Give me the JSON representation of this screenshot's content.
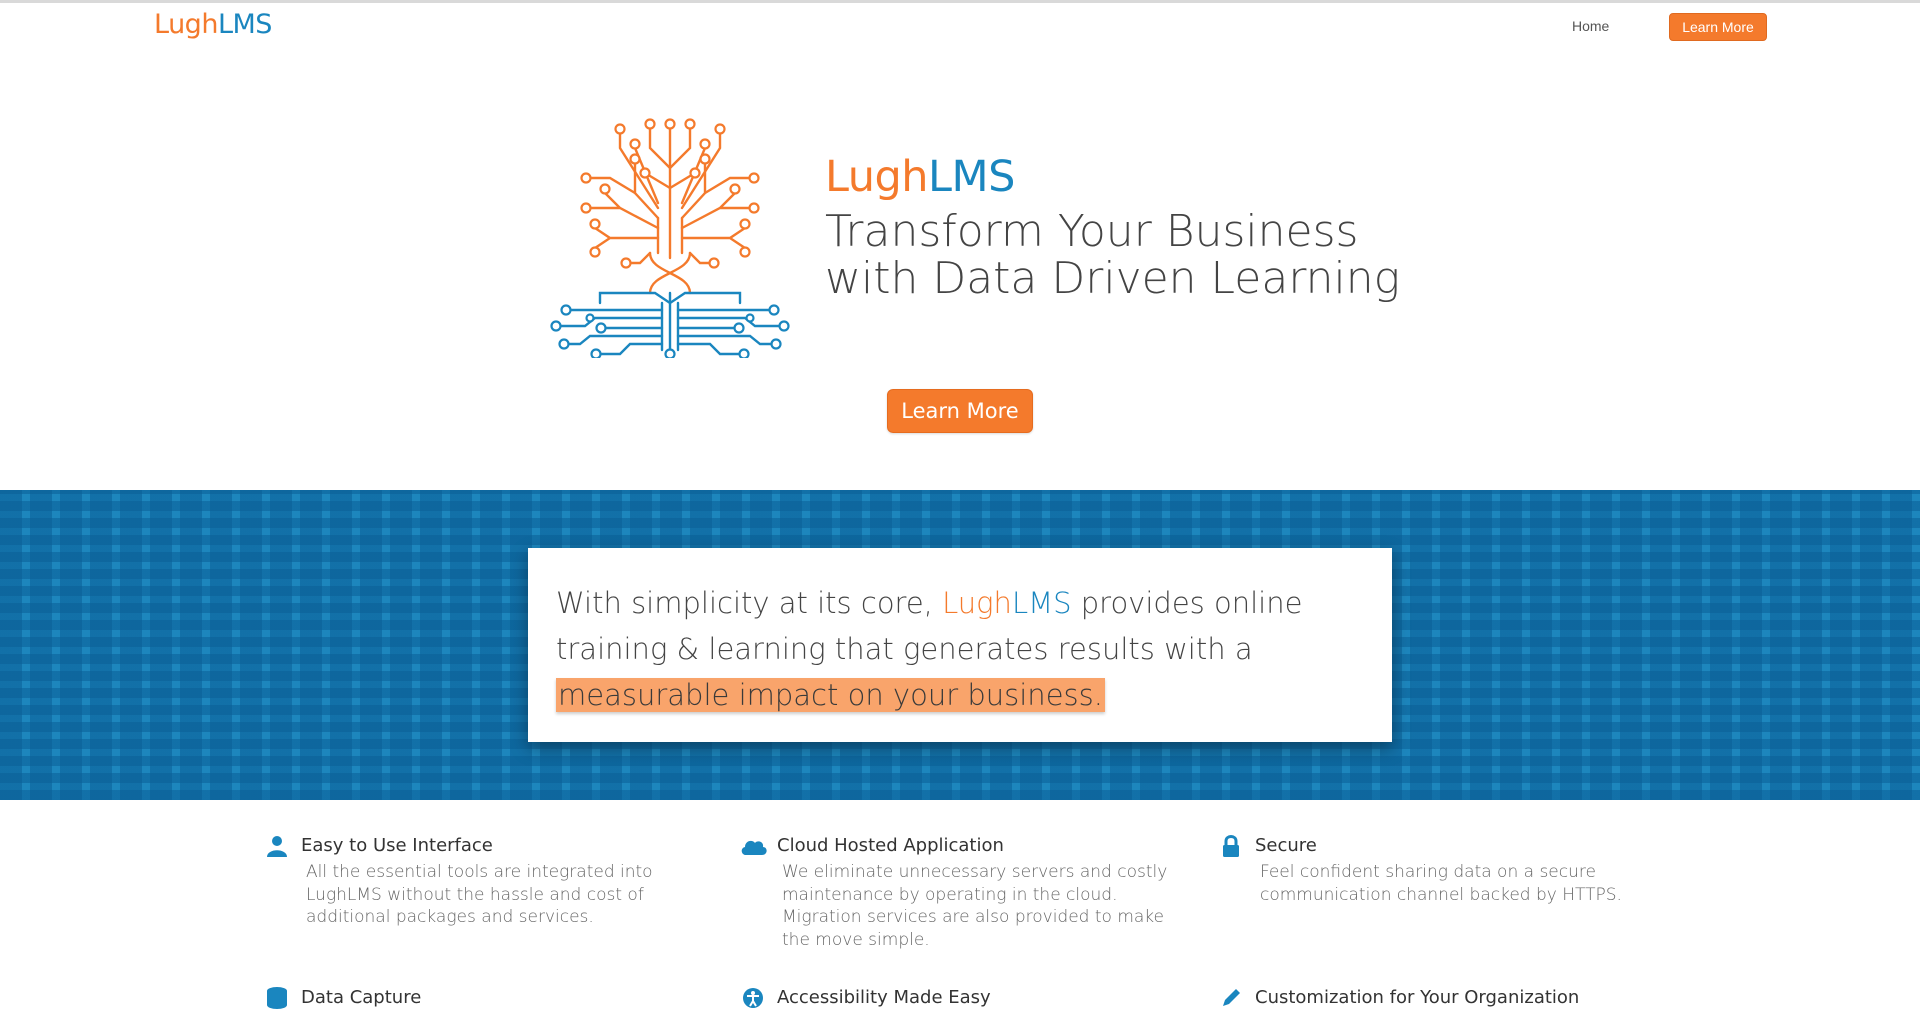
{
  "brand": {
    "part1": "Lugh",
    "part2": "LMS",
    "colors": {
      "orange": "#f47a2c",
      "blue": "#1a86bf"
    }
  },
  "nav": {
    "home_label": "Home",
    "cta_label": "Learn More"
  },
  "hero": {
    "headline": "Transform Your Business with Data Driven Learning",
    "cta_label": "Learn More",
    "logo_icon": "circuit-tree-icon"
  },
  "band": {
    "text_before": "With simplicity at its core, ",
    "brand_part1": "Lugh",
    "brand_part2": "LMS",
    "text_middle": " provides online training & learning that generates results with a ",
    "highlight": "measurable impact on your business.",
    "highlight_color": "#f9a46b",
    "background_color": "#1d86bd"
  },
  "features": [
    {
      "title": "Easy to Use Interface",
      "icon": "user-icon",
      "description": "All the essential tools are integrated into LughLMS without the hassle and cost of additional packages and services."
    },
    {
      "title": "Cloud Hosted Application",
      "icon": "cloud-icon",
      "description": "We eliminate unnecessary servers and costly maintenance by operating in the cloud. Migration services are also provided to make the move simple."
    },
    {
      "title": "Secure",
      "icon": "lock-icon",
      "description": "Feel confident sharing data on a secure communication channel backed by HTTPS."
    },
    {
      "title": "Data Capture",
      "icon": "database-icon",
      "description": ""
    },
    {
      "title": "Accessibility Made Easy",
      "icon": "accessibility-icon",
      "description": ""
    },
    {
      "title": "Customization for Your Organization",
      "icon": "pencil-icon",
      "description": ""
    }
  ]
}
